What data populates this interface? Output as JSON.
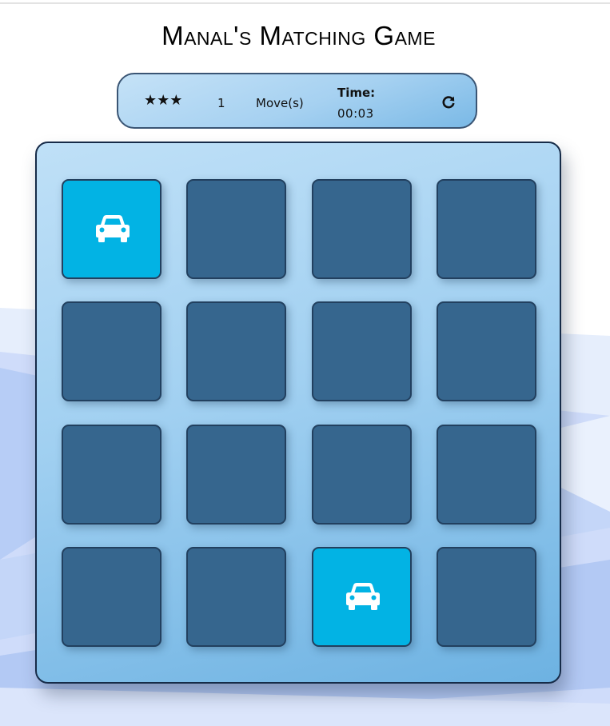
{
  "title": "Manal's Matching Game",
  "score_panel": {
    "stars": [
      "★",
      "★",
      "★"
    ],
    "moves_count": "1",
    "moves_label": "Move(s)",
    "time_label": "Time:",
    "time_value": "00:03",
    "restart_icon": "restart-icon"
  },
  "deck": {
    "rows": 4,
    "columns": 4,
    "cards": [
      {
        "state": "open",
        "icon": "car-icon"
      },
      {
        "state": "closed"
      },
      {
        "state": "closed"
      },
      {
        "state": "closed"
      },
      {
        "state": "closed"
      },
      {
        "state": "closed"
      },
      {
        "state": "closed"
      },
      {
        "state": "closed"
      },
      {
        "state": "closed"
      },
      {
        "state": "closed"
      },
      {
        "state": "closed"
      },
      {
        "state": "closed"
      },
      {
        "state": "closed"
      },
      {
        "state": "closed"
      },
      {
        "state": "open",
        "icon": "car-icon"
      },
      {
        "state": "closed"
      }
    ]
  },
  "colors": {
    "card_closed": "#36668e",
    "card_open": "#02b3e4",
    "panel_border": "#3a5574",
    "deck_border": "#162b48"
  }
}
